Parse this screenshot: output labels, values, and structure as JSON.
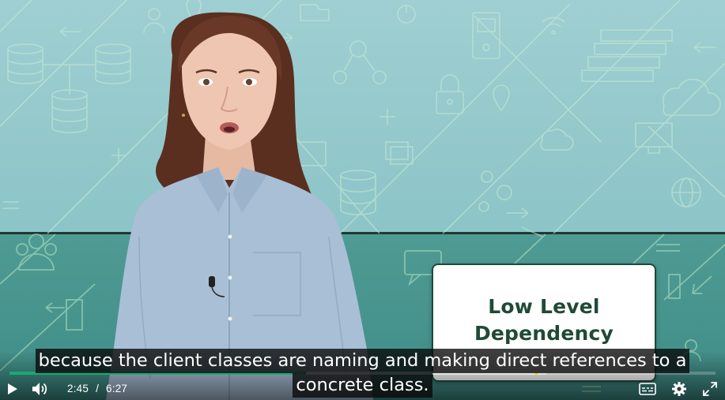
{
  "video": {
    "title_card": {
      "line1": "Low Level",
      "line2": "Dependency"
    },
    "captions": {
      "line1": "because the client classes are naming and making direct references to a",
      "line2": "concrete class."
    }
  },
  "controls": {
    "current_time": "2:45",
    "separator": "/",
    "duration": "6:27",
    "progress_played_fraction": 0.42,
    "progress_loaded_fraction": 0.76,
    "icons": {
      "play": "play-icon",
      "volume": "volume-icon",
      "captions": "captions-icon",
      "settings": "gear-icon",
      "fullscreen": "fullscreen-icon"
    }
  },
  "colors": {
    "progress_played": "#19a974",
    "progress_marker": "#ffd400",
    "title_text": "#1f4a36"
  }
}
